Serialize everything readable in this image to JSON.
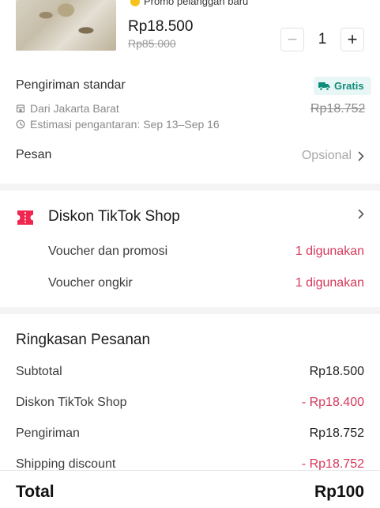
{
  "product": {
    "promo_badge": "Promo pelanggan baru",
    "price": "Rp18.500",
    "original_price": "Rp85.000",
    "quantity": "1",
    "minus_label": "−",
    "plus_label": "+"
  },
  "shipping": {
    "title": "Pengiriman standar",
    "badge": "Gratis",
    "origin": "Dari Jakarta Barat",
    "estimate": "Estimasi pengantaran: Sep 13–Sep 16",
    "price": "Rp18.752"
  },
  "message": {
    "label": "Pesan",
    "placeholder": "Opsional"
  },
  "discount": {
    "title": "Diskon TikTok Shop",
    "rows": [
      {
        "label": "Voucher dan promosi",
        "value": "1 digunakan"
      },
      {
        "label": "Voucher ongkir",
        "value": "1 digunakan"
      }
    ]
  },
  "summary": {
    "title": "Ringkasan Pesanan",
    "rows": [
      {
        "label": "Subtotal",
        "value": "Rp18.500"
      },
      {
        "label": "Diskon TikTok Shop",
        "value": "- Rp18.400"
      },
      {
        "label": "Pengiriman",
        "value": "Rp18.752"
      },
      {
        "label": "Shipping discount",
        "value": "- Rp18.752"
      }
    ],
    "total_label": "Total",
    "total_value": "Rp100"
  },
  "colors": {
    "accent_red": "#d6385a",
    "gratis_green": "#0f8c7a",
    "promo_yellow": "#f6c31a"
  }
}
